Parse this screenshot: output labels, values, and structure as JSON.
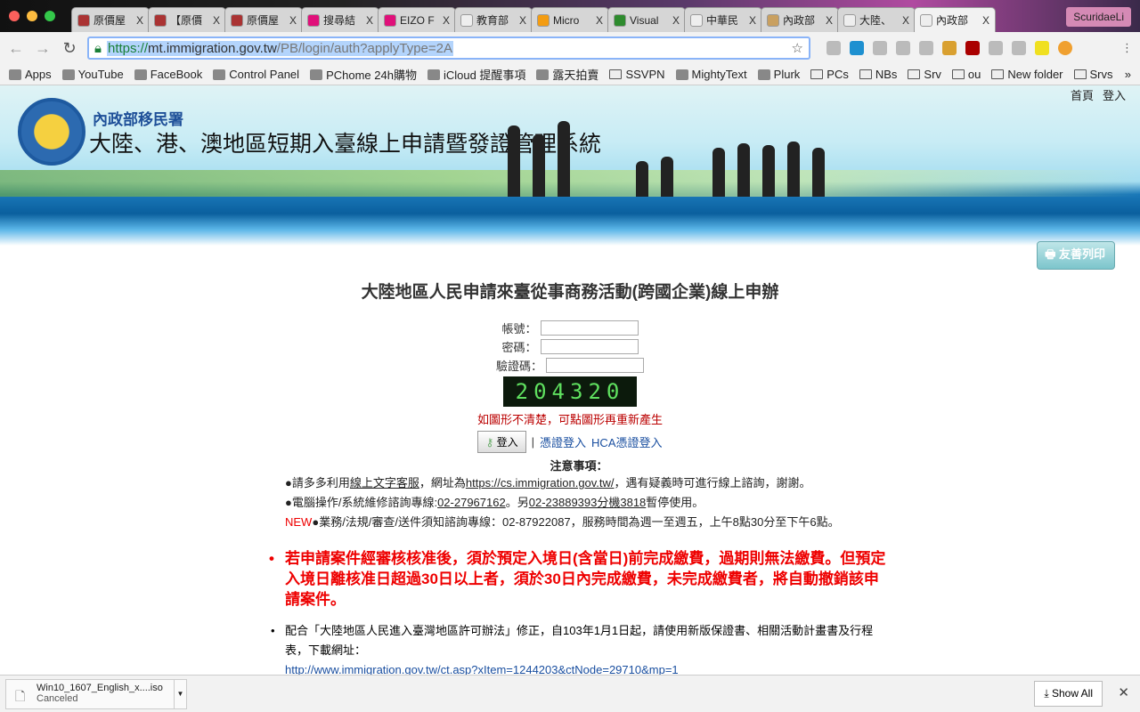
{
  "browser": {
    "tabs": [
      {
        "label": "原價屋",
        "color": "#a33"
      },
      {
        "label": "【原價",
        "color": "#a33"
      },
      {
        "label": "原價屋",
        "color": "#a33"
      },
      {
        "label": "搜尋結",
        "color": "#e0107a"
      },
      {
        "label": "EIZO F",
        "color": "#e0107a"
      },
      {
        "label": "教育部",
        "color": "#eee"
      },
      {
        "label": "Micro",
        "color": "#f39c12"
      },
      {
        "label": "Visual",
        "color": "#2e8b2e"
      },
      {
        "label": "中華民",
        "color": "#eee"
      },
      {
        "label": "內政部",
        "color": "#c9a060"
      },
      {
        "label": "大陸、",
        "color": "#eee"
      },
      {
        "label": "內政部",
        "color": "#eee"
      }
    ],
    "close_glyph": "X",
    "profile": "ScuridaeLi",
    "url_scheme": "https://",
    "url_host": "mt.immigration.gov.tw",
    "url_path": "/PB/login/auth?applyType=2A",
    "bookmarks": [
      {
        "label": "Apps",
        "type": "icon"
      },
      {
        "label": "YouTube",
        "type": "icon"
      },
      {
        "label": "FaceBook",
        "type": "icon"
      },
      {
        "label": "Control Panel",
        "type": "icon"
      },
      {
        "label": "PChome 24h購物",
        "type": "icon"
      },
      {
        "label": "iCloud 提醒事項",
        "type": "icon"
      },
      {
        "label": "露天拍賣",
        "type": "icon"
      },
      {
        "label": "SSVPN",
        "type": "folder"
      },
      {
        "label": "MightyText",
        "type": "icon"
      },
      {
        "label": "Plurk",
        "type": "icon"
      },
      {
        "label": "PCs",
        "type": "folder"
      },
      {
        "label": "NBs",
        "type": "folder"
      },
      {
        "label": "Srv",
        "type": "folder"
      },
      {
        "label": "ou",
        "type": "folder"
      },
      {
        "label": "New folder",
        "type": "folder"
      },
      {
        "label": "Srvs",
        "type": "folder"
      }
    ],
    "more": "»"
  },
  "topnav": {
    "home": "首頁",
    "login": "登入"
  },
  "banner": {
    "org": "內政部移民署",
    "system": "大陸、港、澳地區短期入臺線上申請暨發證管理系統"
  },
  "print_button": "友善列印",
  "page_title": "大陸地區人民申請來臺從事商務活動(跨國企業)線上申辦",
  "form": {
    "account_label": "帳號：",
    "password_label": "密碼：",
    "captcha_label": "驗證碼：",
    "captcha_value": "204320",
    "captcha_hint": "如圖形不清楚，可點圖形再重新產生",
    "login_button": "登入",
    "separator": "|",
    "cert_login": "憑證登入",
    "hca_login": "HCA憑證登入"
  },
  "notes": {
    "heading": "注意事項：",
    "line1_a": "●請多多利用",
    "line1_link": "線上文字客服",
    "line1_b": "，網址為",
    "line1_url": "https://cs.immigration.gov.tw/",
    "line1_c": "，遇有疑義時可進行線上諮詢，謝謝。",
    "line2_a": "●電腦操作/系統維修諮詢專線:",
    "line2_phone": "02-27967162",
    "line2_b": "。另",
    "line2_phone2": "02-23889393分機3818",
    "line2_c": "暫停使用。",
    "line3_new": "NEW",
    "line3": "●業務/法規/審查/送件須知諮詢專線：02-87922087，服務時間為週一至週五，上午8點30分至下午6點。"
  },
  "warning": "若申請案件經審核核准後，須於預定入境日(含當日)前完成繳費，過期則無法繳費。但預定入境日離核准日超過30日以上者，須於30日內完成繳費，未完成繳費者，將自動撤銷該申請案件。",
  "notice2": "配合「大陸地區人民進入臺灣地區許可辦法」修正，自103年1月1日起，請使用新版保證書、相關活動計畫書及行程表，下載網址：",
  "notice2_link": "http://www.immigration.gov.tw/ct.asp?xItem=1244203&ctNode=29710&mp=1",
  "downloads": {
    "file": "Win10_1607_English_x....iso",
    "status": "Canceled",
    "show_all": "Show All",
    "close": "✕"
  }
}
